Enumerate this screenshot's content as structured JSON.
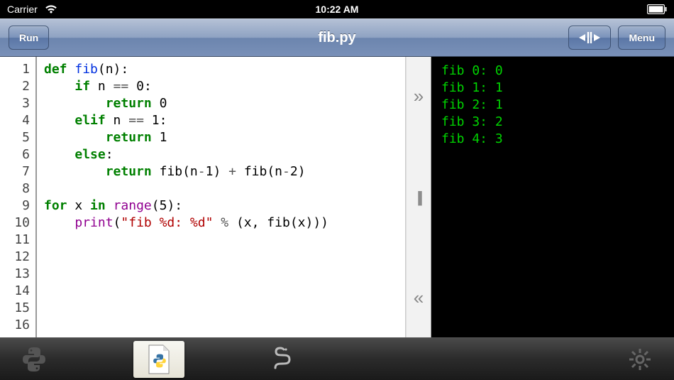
{
  "status": {
    "carrier": "Carrier",
    "time": "10:22 AM"
  },
  "nav": {
    "run_label": "Run",
    "title": "fib.py",
    "menu_label": "Menu"
  },
  "editor": {
    "line_count": 16,
    "tokens": [
      [
        [
          "kw",
          "def"
        ],
        [
          "",
          " "
        ],
        [
          "fn",
          "fib"
        ],
        [
          "",
          "(n):"
        ]
      ],
      [
        [
          "",
          "    "
        ],
        [
          "kw",
          "if"
        ],
        [
          "",
          " n "
        ],
        [
          "op",
          "=="
        ],
        [
          "",
          " "
        ],
        [
          "num",
          "0"
        ],
        [
          "",
          ":"
        ]
      ],
      [
        [
          "",
          "        "
        ],
        [
          "kw",
          "return"
        ],
        [
          "",
          " "
        ],
        [
          "num",
          "0"
        ]
      ],
      [
        [
          "",
          "    "
        ],
        [
          "kw",
          "elif"
        ],
        [
          "",
          " n "
        ],
        [
          "op",
          "=="
        ],
        [
          "",
          " "
        ],
        [
          "num",
          "1"
        ],
        [
          "",
          ":"
        ]
      ],
      [
        [
          "",
          "        "
        ],
        [
          "kw",
          "return"
        ],
        [
          "",
          " "
        ],
        [
          "num",
          "1"
        ]
      ],
      [
        [
          "",
          "    "
        ],
        [
          "kw",
          "else"
        ],
        [
          "",
          ":"
        ]
      ],
      [
        [
          "",
          "        "
        ],
        [
          "kw",
          "return"
        ],
        [
          "",
          " fib(n"
        ],
        [
          "op",
          "-"
        ],
        [
          "num",
          "1"
        ],
        [
          "",
          ") "
        ],
        [
          "op",
          "+"
        ],
        [
          "",
          " fib(n"
        ],
        [
          "op",
          "-"
        ],
        [
          "num",
          "2"
        ],
        [
          "",
          ")"
        ]
      ],
      [],
      [
        [
          "kw",
          "for"
        ],
        [
          "",
          " x "
        ],
        [
          "kw",
          "in"
        ],
        [
          "",
          " "
        ],
        [
          "builtin",
          "range"
        ],
        [
          "",
          "("
        ],
        [
          "num",
          "5"
        ],
        [
          "",
          "):"
        ]
      ],
      [
        [
          "",
          "    "
        ],
        [
          "builtin",
          "print"
        ],
        [
          "",
          "("
        ],
        [
          "str",
          "\"fib %d: %d\""
        ],
        [
          "",
          " "
        ],
        [
          "op",
          "%"
        ],
        [
          "",
          " (x, fib(x)))"
        ]
      ],
      [],
      [],
      [],
      [],
      [],
      []
    ]
  },
  "console": {
    "lines": [
      "fib 0: 0",
      "fib 1: 1",
      "fib 2: 1",
      "fib 3: 2",
      "fib 4: 3"
    ]
  },
  "icons": {
    "wifi": "wifi",
    "battery": "battery",
    "split": "split",
    "python_dark": "python",
    "file_py": "file",
    "snake": "snake",
    "gear": "gear"
  }
}
